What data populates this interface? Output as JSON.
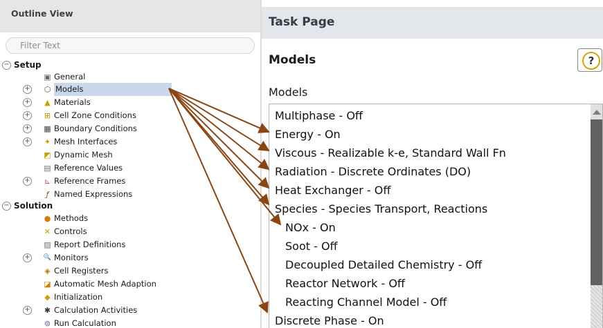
{
  "outline": {
    "title": "Outline View",
    "filter_placeholder": "Filter Text",
    "items": [
      {
        "label": "Setup",
        "toggle": "−",
        "icon": ""
      },
      {
        "label": "General",
        "toggle": "",
        "icon": "▣"
      },
      {
        "label": "Models",
        "toggle": "+",
        "icon": "⬡"
      },
      {
        "label": "Materials",
        "toggle": "+",
        "icon": "▲"
      },
      {
        "label": "Cell Zone Conditions",
        "toggle": "+",
        "icon": "⊞"
      },
      {
        "label": "Boundary Conditions",
        "toggle": "+",
        "icon": "▦"
      },
      {
        "label": "Mesh Interfaces",
        "toggle": "+",
        "icon": "✦"
      },
      {
        "label": "Dynamic Mesh",
        "toggle": "",
        "icon": "◩"
      },
      {
        "label": "Reference Values",
        "toggle": "",
        "icon": "▤"
      },
      {
        "label": "Reference Frames",
        "toggle": "+",
        "icon": "⊾"
      },
      {
        "label": "Named Expressions",
        "toggle": "",
        "icon": "ƒ"
      },
      {
        "label": "Solution",
        "toggle": "−",
        "icon": ""
      },
      {
        "label": "Methods",
        "toggle": "",
        "icon": "●"
      },
      {
        "label": "Controls",
        "toggle": "",
        "icon": "✕"
      },
      {
        "label": "Report Definitions",
        "toggle": "",
        "icon": "▨"
      },
      {
        "label": "Monitors",
        "toggle": "+",
        "icon": "🔍"
      },
      {
        "label": "Cell Registers",
        "toggle": "",
        "icon": "◈"
      },
      {
        "label": "Automatic Mesh Adaption",
        "toggle": "",
        "icon": "◪"
      },
      {
        "label": "Initialization",
        "toggle": "",
        "icon": "◆"
      },
      {
        "label": "Calculation Activities",
        "toggle": "+",
        "icon": "✱"
      },
      {
        "label": "Run Calculation",
        "toggle": "",
        "icon": "⊜"
      }
    ]
  },
  "task_page": {
    "title": "Task Page",
    "section_title": "Models",
    "help_symbol": "?",
    "group_label": "Models",
    "models": [
      "Multiphase - Off",
      "Energy - On",
      "Viscous - Realizable k-e, Standard Wall Fn",
      "Radiation - Discrete Ordinates (DO)",
      "Heat Exchanger - Off",
      "Species - Species Transport, Reactions",
      "NOx - On",
      "Soot - Off",
      "Decoupled Detailed Chemistry - Off",
      "Reactor Network - Off",
      "Reacting Channel Model - Off",
      "Discrete Phase - On"
    ]
  },
  "colors": {
    "selection": "#c9d8ea",
    "arrow": "#8b4513",
    "scroll_thumb": "#616161",
    "task_header": "#e3e7ec"
  }
}
